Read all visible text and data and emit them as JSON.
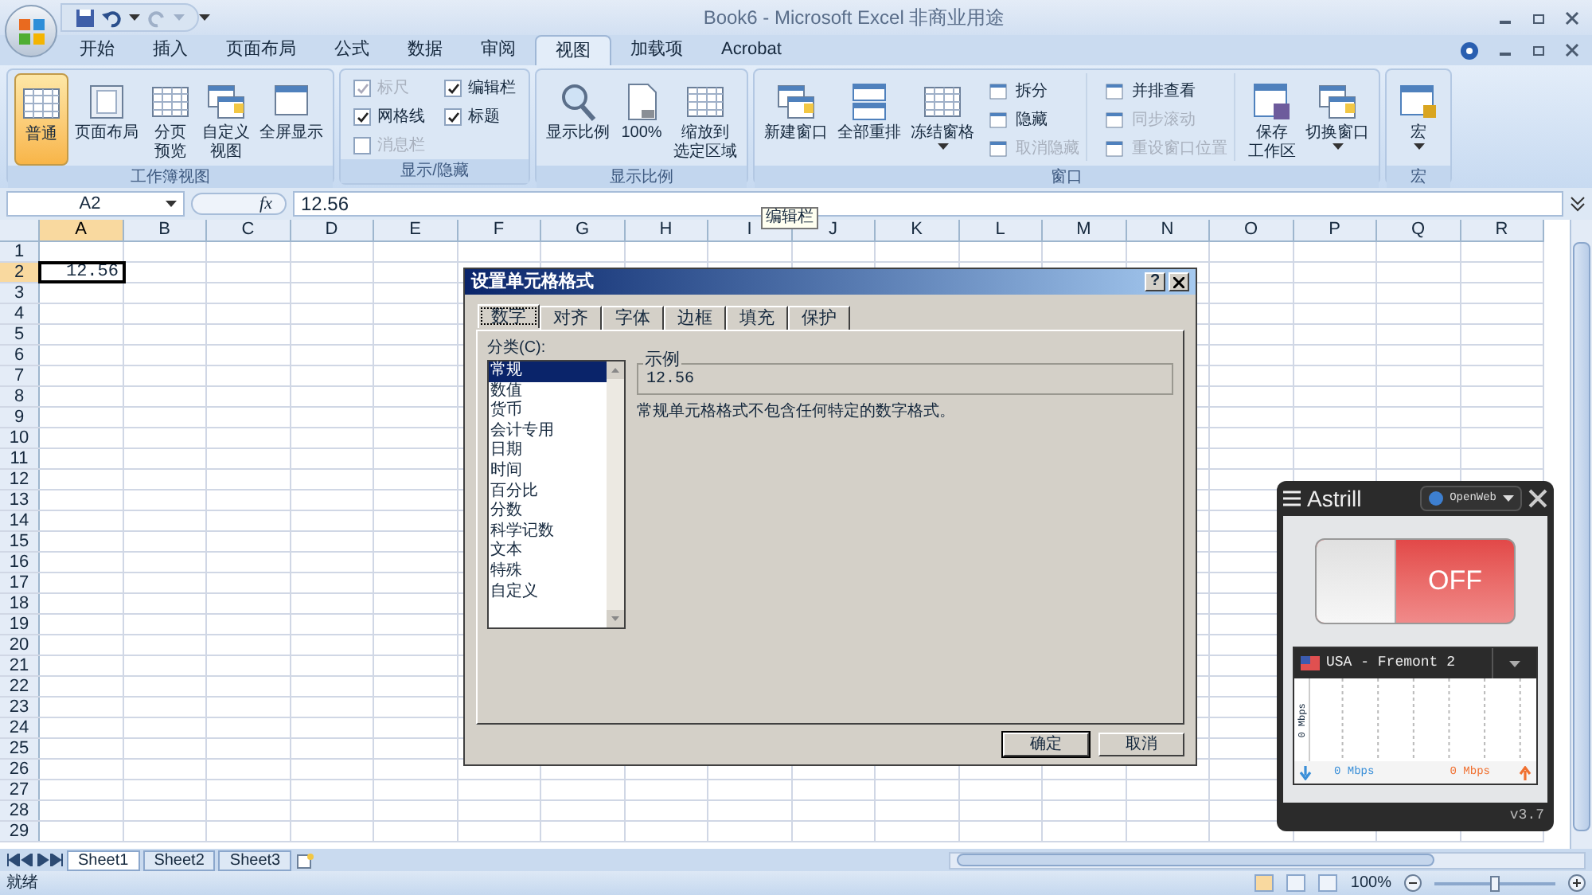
{
  "window": {
    "title": "Book6 - Microsoft Excel 非商业用途"
  },
  "ribbon_tabs": [
    {
      "label": "开始",
      "selected": false
    },
    {
      "label": "插入",
      "selected": false
    },
    {
      "label": "页面布局",
      "selected": false
    },
    {
      "label": "公式",
      "selected": false
    },
    {
      "label": "数据",
      "selected": false
    },
    {
      "label": "审阅",
      "selected": false
    },
    {
      "label": "视图",
      "selected": true
    },
    {
      "label": "加载项",
      "selected": false
    },
    {
      "label": "Acrobat",
      "selected": false
    }
  ],
  "ribbon_groups": [
    {
      "label": "工作簿视图",
      "items": [
        {
          "kind": "large",
          "lines": [
            "普通"
          ],
          "selected": true
        },
        {
          "kind": "large",
          "lines": [
            "页面布局"
          ],
          "selected": false
        },
        {
          "kind": "large",
          "lines": [
            "分页",
            "预览"
          ],
          "selected": false
        },
        {
          "kind": "large",
          "lines": [
            "自定义",
            "视图"
          ],
          "selected": false
        },
        {
          "kind": "large",
          "lines": [
            "全屏显示"
          ],
          "selected": false
        }
      ]
    },
    {
      "label": "显示/隐藏",
      "items": [
        {
          "kind": "check",
          "label": "标尺",
          "checked": true,
          "disabled": true
        },
        {
          "kind": "check",
          "label": "网格线",
          "checked": true,
          "disabled": false
        },
        {
          "kind": "check",
          "label": "消息栏",
          "checked": false,
          "disabled": true
        },
        {
          "kind": "check",
          "label": "编辑栏",
          "checked": true,
          "disabled": false
        },
        {
          "kind": "check",
          "label": "标题",
          "checked": true,
          "disabled": false
        }
      ]
    },
    {
      "label": "显示比例",
      "items": [
        {
          "kind": "large",
          "lines": [
            "显示比例"
          ],
          "selected": false
        },
        {
          "kind": "large",
          "lines": [
            "100%"
          ],
          "selected": false
        },
        {
          "kind": "large",
          "lines": [
            "缩放到",
            "选定区域"
          ],
          "selected": false
        }
      ]
    },
    {
      "label": "窗口",
      "items": [
        {
          "kind": "large",
          "lines": [
            "新建窗口"
          ],
          "selected": false
        },
        {
          "kind": "large",
          "lines": [
            "全部重排"
          ],
          "selected": false
        },
        {
          "kind": "large",
          "lines": [
            "冻结窗格"
          ],
          "selected": false,
          "dropdown": true
        },
        {
          "kind": "stack",
          "items": [
            {
              "label": "拆分",
              "disabled": false
            },
            {
              "label": "隐藏",
              "disabled": false
            },
            {
              "label": "取消隐藏",
              "disabled": true
            }
          ]
        },
        {
          "kind": "stack",
          "items": [
            {
              "label": "并排查看",
              "disabled": false
            },
            {
              "label": "同步滚动",
              "disabled": true
            },
            {
              "label": "重设窗口位置",
              "disabled": true
            }
          ]
        },
        {
          "kind": "large",
          "lines": [
            "保存",
            "工作区"
          ],
          "selected": false
        },
        {
          "kind": "large",
          "lines": [
            "切换窗口"
          ],
          "selected": false,
          "dropdown": true
        }
      ]
    },
    {
      "label": "宏",
      "items": [
        {
          "kind": "large",
          "lines": [
            "宏"
          ],
          "selected": false,
          "dropdown": true
        }
      ]
    }
  ],
  "formula_bar": {
    "name_box": "A2",
    "fx": "fx",
    "value": "12.56",
    "tooltip": "编辑栏"
  },
  "sheet": {
    "columns": [
      {
        "label": "A",
        "selected": true
      },
      {
        "label": "B",
        "selected": false
      },
      {
        "label": "C",
        "selected": false
      },
      {
        "label": "D",
        "selected": false
      },
      {
        "label": "E",
        "selected": false
      },
      {
        "label": "F",
        "selected": false
      },
      {
        "label": "G",
        "selected": false
      },
      {
        "label": "H",
        "selected": false
      },
      {
        "label": "I",
        "selected": false
      },
      {
        "label": "J",
        "selected": false
      },
      {
        "label": "K",
        "selected": false
      },
      {
        "label": "L",
        "selected": false
      },
      {
        "label": "M",
        "selected": false
      },
      {
        "label": "N",
        "selected": false
      },
      {
        "label": "O",
        "selected": false
      },
      {
        "label": "P",
        "selected": false
      },
      {
        "label": "Q",
        "selected": false
      },
      {
        "label": "R",
        "selected": false
      }
    ],
    "rows": [
      {
        "label": "1",
        "selected": false
      },
      {
        "label": "2",
        "selected": true,
        "cells": [
          "12.56"
        ]
      },
      {
        "label": "3",
        "selected": false
      },
      {
        "label": "4",
        "selected": false
      },
      {
        "label": "5",
        "selected": false
      },
      {
        "label": "6",
        "selected": false
      },
      {
        "label": "7",
        "selected": false
      },
      {
        "label": "8",
        "selected": false
      },
      {
        "label": "9",
        "selected": false
      },
      {
        "label": "10",
        "selected": false
      },
      {
        "label": "11",
        "selected": false
      },
      {
        "label": "12",
        "selected": false
      },
      {
        "label": "13",
        "selected": false
      },
      {
        "label": "14",
        "selected": false
      },
      {
        "label": "15",
        "selected": false
      },
      {
        "label": "16",
        "selected": false
      },
      {
        "label": "17",
        "selected": false
      },
      {
        "label": "18",
        "selected": false
      },
      {
        "label": "19",
        "selected": false
      },
      {
        "label": "20",
        "selected": false
      },
      {
        "label": "21",
        "selected": false
      },
      {
        "label": "22",
        "selected": false
      },
      {
        "label": "23",
        "selected": false
      },
      {
        "label": "24",
        "selected": false
      },
      {
        "label": "25",
        "selected": false
      },
      {
        "label": "26",
        "selected": false
      },
      {
        "label": "27",
        "selected": false
      },
      {
        "label": "28",
        "selected": false
      },
      {
        "label": "29",
        "selected": false
      }
    ]
  },
  "sheet_tabs": [
    {
      "label": "Sheet1",
      "selected": true
    },
    {
      "label": "Sheet2",
      "selected": false
    },
    {
      "label": "Sheet3",
      "selected": false
    }
  ],
  "status_bar": {
    "status": "就绪",
    "zoom": "100%",
    "zoom_slider": {
      "level": 0.5
    },
    "views": [
      {
        "selected": true
      },
      {
        "selected": false
      },
      {
        "selected": false
      }
    ]
  },
  "dialog": {
    "title": "设置单元格格式",
    "help": "?",
    "tabs": [
      {
        "label": "数字",
        "selected": true
      },
      {
        "label": "对齐",
        "selected": false
      },
      {
        "label": "字体",
        "selected": false
      },
      {
        "label": "边框",
        "selected": false
      },
      {
        "label": "填充",
        "selected": false
      },
      {
        "label": "保护",
        "selected": false
      }
    ],
    "category_label": "分类(C):",
    "categories": [
      {
        "label": "常规",
        "selected": true
      },
      {
        "label": "数值",
        "selected": false
      },
      {
        "label": "货币",
        "selected": false
      },
      {
        "label": "会计专用",
        "selected": false
      },
      {
        "label": "日期",
        "selected": false
      },
      {
        "label": "时间",
        "selected": false
      },
      {
        "label": "百分比",
        "selected": false
      },
      {
        "label": "分数",
        "selected": false
      },
      {
        "label": "科学记数",
        "selected": false
      },
      {
        "label": "文本",
        "selected": false
      },
      {
        "label": "特殊",
        "selected": false
      },
      {
        "label": "自定义",
        "selected": false
      }
    ],
    "sample_label": "示例",
    "sample_value": "12.56",
    "description": "常规单元格格式不包含任何特定的数字格式。",
    "buttons": [
      "确定",
      "取消"
    ]
  },
  "vpn_widget": {
    "title": "Astrill",
    "mode": "OpenWeb",
    "toggle": {
      "label": "OFF",
      "on": false
    },
    "server": "USA - Fremont 2",
    "graph_axis": "0 Mbps",
    "download": "0 Mbps",
    "upload": "0 Mbps",
    "version": "v3.7"
  }
}
